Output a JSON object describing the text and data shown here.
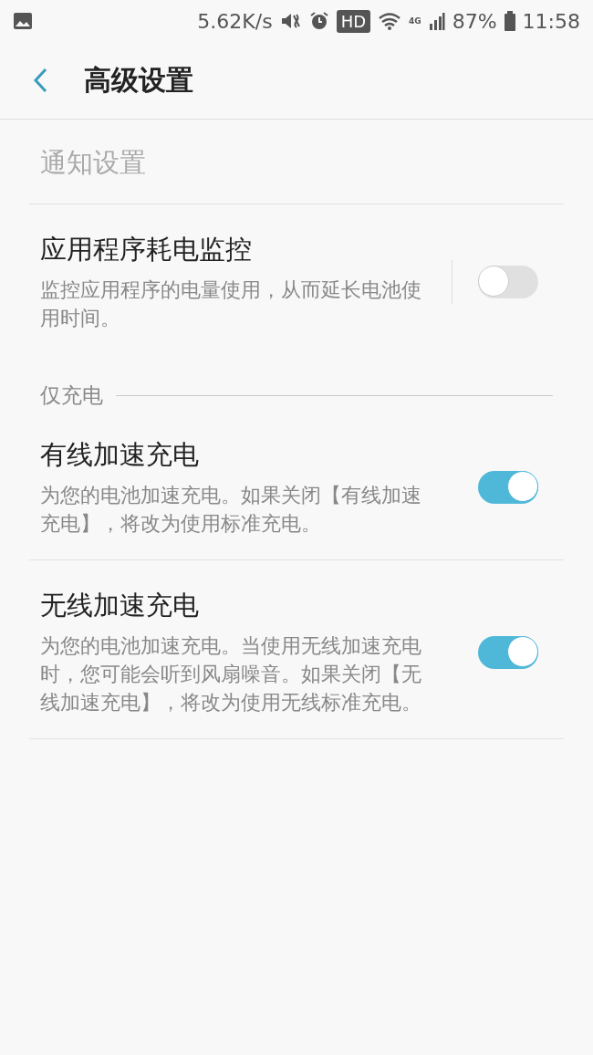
{
  "status_bar": {
    "speed": "5.62K/s",
    "hd": "HD",
    "network": "4G",
    "battery": "87%",
    "time": "11:58"
  },
  "header": {
    "title": "高级设置"
  },
  "sections": [
    {
      "kind": "link",
      "title": "通知设置",
      "disabled": true
    },
    {
      "kind": "toggle",
      "title": "应用程序耗电监控",
      "description": "监控应用程序的电量使用，从而延长电池使用时间。",
      "on": false,
      "divider": true
    },
    {
      "kind": "header",
      "title": "仅充电"
    },
    {
      "kind": "toggle",
      "title": "有线加速充电",
      "description": "为您的电池加速充电。如果关闭【有线加速充电】，将改为使用标准充电。",
      "on": true,
      "divider": false
    },
    {
      "kind": "toggle",
      "title": "无线加速充电",
      "description": "为您的电池加速充电。当使用无线加速充电时，您可能会听到风扇噪音。如果关闭【无线加速充电】，将改为使用无线标准充电。",
      "on": true,
      "divider": false
    }
  ]
}
